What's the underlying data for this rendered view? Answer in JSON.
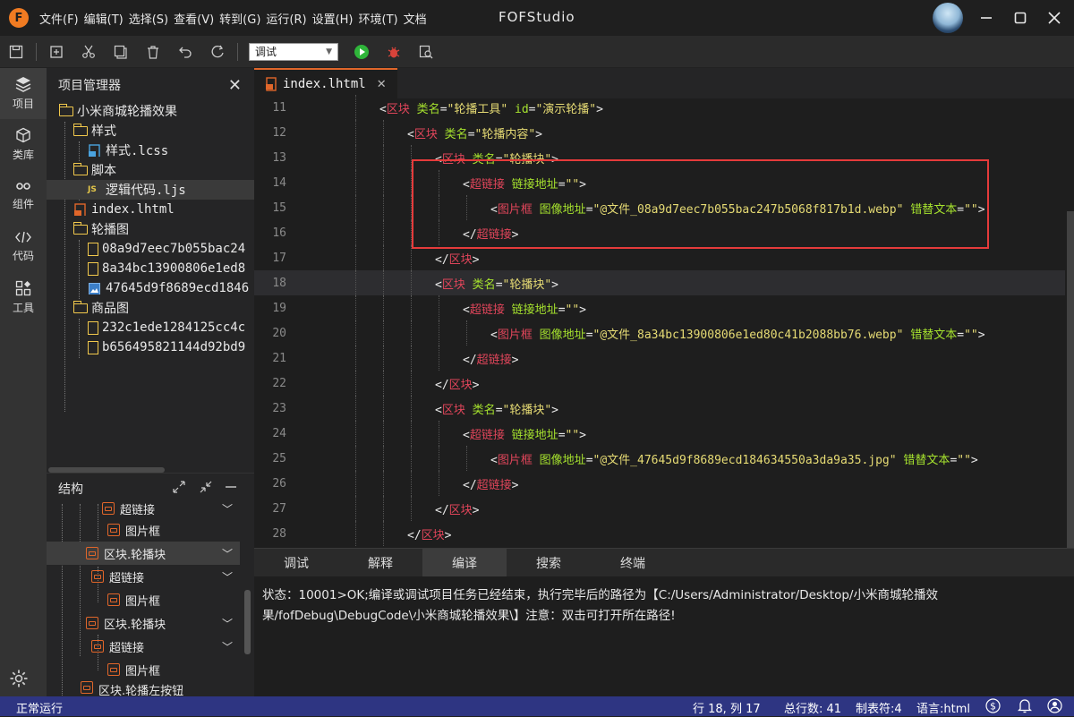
{
  "window": {
    "app_title": "FOFStudio",
    "menu": [
      "文件(F)",
      "编辑(T)",
      "选择(S)",
      "查看(V)",
      "转到(G)",
      "运行(R)",
      "设置(H)",
      "环境(T)",
      "文档"
    ]
  },
  "toolbar": {
    "mode_value": "调试"
  },
  "activity_bar": [
    {
      "label": "项目",
      "icon": "layers-icon"
    },
    {
      "label": "类库",
      "icon": "cube-icon"
    },
    {
      "label": "组件",
      "icon": "link-icon"
    },
    {
      "label": "代码",
      "icon": "code-icon"
    },
    {
      "label": "工具",
      "icon": "tools-icon"
    }
  ],
  "explorer": {
    "title": "项目管理器",
    "tree": [
      {
        "label": "小米商城轮播效果",
        "kind": "folder"
      },
      {
        "label": "样式",
        "kind": "folder"
      },
      {
        "label": "样式.lcss",
        "kind": "css"
      },
      {
        "label": "脚本",
        "kind": "folder"
      },
      {
        "label": "逻辑代码.ljs",
        "kind": "js"
      },
      {
        "label": "index.lhtml",
        "kind": "html"
      },
      {
        "label": "轮播图",
        "kind": "folder"
      },
      {
        "label": "08a9d7eec7b055bac24",
        "kind": "file"
      },
      {
        "label": "8a34bc13900806e1ed8",
        "kind": "file"
      },
      {
        "label": "47645d9f8689ecd1846",
        "kind": "image"
      },
      {
        "label": "商品图",
        "kind": "folder"
      },
      {
        "label": "232c1ede1284125cc4c",
        "kind": "file"
      },
      {
        "label": "b656495821144d92bd9",
        "kind": "file"
      }
    ]
  },
  "structure": {
    "title": "结构",
    "nodes": [
      {
        "label": "超链接"
      },
      {
        "label": "图片框"
      },
      {
        "label": "区块.轮播块"
      },
      {
        "label": "超链接"
      },
      {
        "label": "图片框"
      },
      {
        "label": "区块.轮播块"
      },
      {
        "label": "超链接"
      },
      {
        "label": "图片框"
      },
      {
        "label": "区块.轮播左按钮"
      }
    ]
  },
  "editor": {
    "tab_label": "index.lhtml",
    "lines": [
      {
        "n": "11",
        "indent": 2,
        "tokens": [
          [
            "b",
            "<"
          ],
          [
            "t",
            "区块"
          ],
          [
            "b",
            " "
          ],
          [
            "a",
            "类名"
          ],
          [
            "b",
            "="
          ],
          [
            "s",
            "\"轮播工具\""
          ],
          [
            "b",
            " "
          ],
          [
            "a",
            "id"
          ],
          [
            "b",
            "="
          ],
          [
            "s",
            "\"演示轮播\""
          ],
          [
            "b",
            ">"
          ]
        ]
      },
      {
        "n": "12",
        "indent": 3,
        "tokens": [
          [
            "b",
            "<"
          ],
          [
            "t",
            "区块"
          ],
          [
            "b",
            " "
          ],
          [
            "a",
            "类名"
          ],
          [
            "b",
            "="
          ],
          [
            "s",
            "\"轮播内容\""
          ],
          [
            "b",
            ">"
          ]
        ]
      },
      {
        "n": "13",
        "indent": 4,
        "tokens": [
          [
            "b",
            "<"
          ],
          [
            "t",
            "区块"
          ],
          [
            "b",
            " "
          ],
          [
            "a",
            "类名"
          ],
          [
            "b",
            "="
          ],
          [
            "s",
            "\"轮播块\""
          ],
          [
            "b",
            ">"
          ]
        ]
      },
      {
        "n": "14",
        "indent": 5,
        "tokens": [
          [
            "b",
            "<"
          ],
          [
            "t",
            "超链接"
          ],
          [
            "b",
            " "
          ],
          [
            "a",
            "链接地址"
          ],
          [
            "b",
            "="
          ],
          [
            "s",
            "\"\""
          ],
          [
            "b",
            ">"
          ]
        ]
      },
      {
        "n": "15",
        "indent": 6,
        "tokens": [
          [
            "b",
            "<"
          ],
          [
            "t",
            "图片框"
          ],
          [
            "b",
            " "
          ],
          [
            "a",
            "图像地址"
          ],
          [
            "b",
            "="
          ],
          [
            "s",
            "\"@文件_08a9d7eec7b055bac247b5068f817b1d.webp\""
          ],
          [
            "b",
            " "
          ],
          [
            "a",
            "错替文本"
          ],
          [
            "b",
            "="
          ],
          [
            "s",
            "\"\""
          ],
          [
            "b",
            ">"
          ]
        ]
      },
      {
        "n": "16",
        "indent": 5,
        "tokens": [
          [
            "b",
            "</"
          ],
          [
            "t",
            "超链接"
          ],
          [
            "b",
            ">"
          ]
        ]
      },
      {
        "n": "17",
        "indent": 4,
        "tokens": [
          [
            "b",
            "</"
          ],
          [
            "t",
            "区块"
          ],
          [
            "b",
            ">"
          ]
        ]
      },
      {
        "n": "18",
        "indent": 4,
        "tokens": [
          [
            "b",
            "<"
          ],
          [
            "t",
            "区块"
          ],
          [
            "b",
            " "
          ],
          [
            "a",
            "类名"
          ],
          [
            "b",
            "="
          ],
          [
            "s",
            "\"轮播块\""
          ],
          [
            "b",
            ">"
          ]
        ]
      },
      {
        "n": "19",
        "indent": 5,
        "tokens": [
          [
            "b",
            "<"
          ],
          [
            "t",
            "超链接"
          ],
          [
            "b",
            " "
          ],
          [
            "a",
            "链接地址"
          ],
          [
            "b",
            "="
          ],
          [
            "s",
            "\"\""
          ],
          [
            "b",
            ">"
          ]
        ]
      },
      {
        "n": "20",
        "indent": 6,
        "tokens": [
          [
            "b",
            "<"
          ],
          [
            "t",
            "图片框"
          ],
          [
            "b",
            " "
          ],
          [
            "a",
            "图像地址"
          ],
          [
            "b",
            "="
          ],
          [
            "s",
            "\"@文件_8a34bc13900806e1ed80c41b2088bb76.webp\""
          ],
          [
            "b",
            " "
          ],
          [
            "a",
            "错替文本"
          ],
          [
            "b",
            "="
          ],
          [
            "s",
            "\"\""
          ],
          [
            "b",
            ">"
          ]
        ]
      },
      {
        "n": "21",
        "indent": 5,
        "tokens": [
          [
            "b",
            "</"
          ],
          [
            "t",
            "超链接"
          ],
          [
            "b",
            ">"
          ]
        ]
      },
      {
        "n": "22",
        "indent": 4,
        "tokens": [
          [
            "b",
            "</"
          ],
          [
            "t",
            "区块"
          ],
          [
            "b",
            ">"
          ]
        ]
      },
      {
        "n": "23",
        "indent": 4,
        "tokens": [
          [
            "b",
            "<"
          ],
          [
            "t",
            "区块"
          ],
          [
            "b",
            " "
          ],
          [
            "a",
            "类名"
          ],
          [
            "b",
            "="
          ],
          [
            "s",
            "\"轮播块\""
          ],
          [
            "b",
            ">"
          ]
        ]
      },
      {
        "n": "24",
        "indent": 5,
        "tokens": [
          [
            "b",
            "<"
          ],
          [
            "t",
            "超链接"
          ],
          [
            "b",
            " "
          ],
          [
            "a",
            "链接地址"
          ],
          [
            "b",
            "="
          ],
          [
            "s",
            "\"\""
          ],
          [
            "b",
            ">"
          ]
        ]
      },
      {
        "n": "25",
        "indent": 6,
        "tokens": [
          [
            "b",
            "<"
          ],
          [
            "t",
            "图片框"
          ],
          [
            "b",
            " "
          ],
          [
            "a",
            "图像地址"
          ],
          [
            "b",
            "="
          ],
          [
            "s",
            "\"@文件_47645d9f8689ecd184634550a3da9a35.jpg\""
          ],
          [
            "b",
            " "
          ],
          [
            "a",
            "错替文本"
          ],
          [
            "b",
            "="
          ],
          [
            "s",
            "\"\""
          ],
          [
            "b",
            ">"
          ]
        ]
      },
      {
        "n": "26",
        "indent": 5,
        "tokens": [
          [
            "b",
            "</"
          ],
          [
            "t",
            "超链接"
          ],
          [
            "b",
            ">"
          ]
        ]
      },
      {
        "n": "27",
        "indent": 4,
        "tokens": [
          [
            "b",
            "</"
          ],
          [
            "t",
            "区块"
          ],
          [
            "b",
            ">"
          ]
        ]
      },
      {
        "n": "28",
        "indent": 3,
        "tokens": [
          [
            "b",
            "</"
          ],
          [
            "t",
            "区块"
          ],
          [
            "b",
            ">"
          ]
        ]
      }
    ]
  },
  "bottom_panel": {
    "tabs": [
      "调试",
      "解释",
      "编译",
      "搜索",
      "终端"
    ],
    "active_tab": "编译",
    "output_line1": "状态：10001>OK;编译或调试项目任务已经结束，执行完毕后的路径为【C:/Users/Administrator/Desktop/小米商城轮播效",
    "output_line2": "果/fofDebug\\DebugCode\\小米商城轮播效果\\】注意：双击可打开所在路径!"
  },
  "status_bar": {
    "left": "正常运行",
    "cursor": "行 18, 列 17",
    "total_lines": "总行数: 41",
    "tab_size": "制表符:4",
    "language": "语言:html"
  }
}
